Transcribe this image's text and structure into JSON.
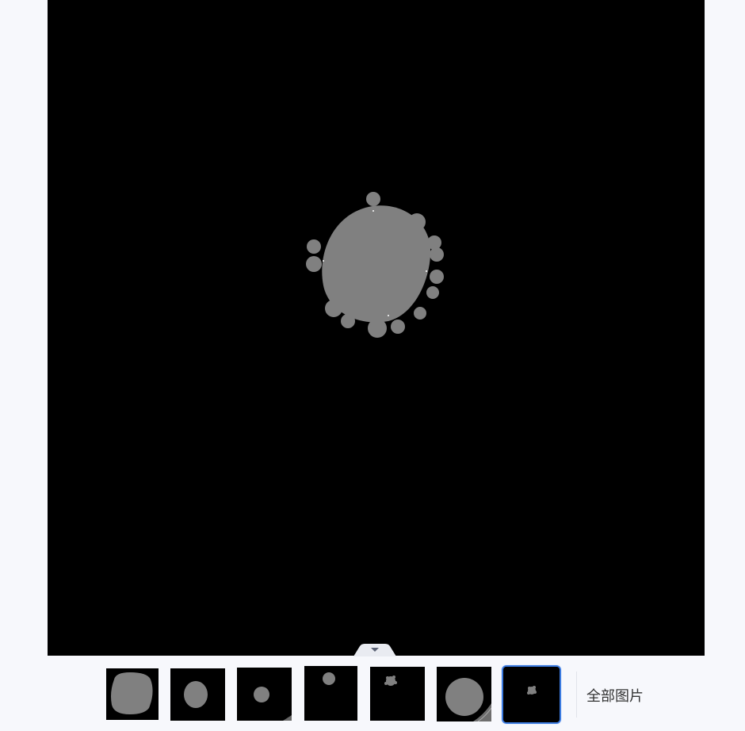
{
  "viewer": {
    "image_name": "segmentation-mask-image",
    "background_color": "#000000",
    "mask_color": "#808080"
  },
  "collapse_toggle": {
    "icon": "triangle-down-icon"
  },
  "thumbnails": [
    {
      "name": "thumbnail-1",
      "selected": false
    },
    {
      "name": "thumbnail-2",
      "selected": false
    },
    {
      "name": "thumbnail-3",
      "selected": false
    },
    {
      "name": "thumbnail-4",
      "selected": false
    },
    {
      "name": "thumbnail-5",
      "selected": false
    },
    {
      "name": "thumbnail-6",
      "selected": false
    },
    {
      "name": "thumbnail-7",
      "selected": true
    }
  ],
  "all_images_label": "全部图片",
  "colors": {
    "selection_border": "#3c7be0",
    "page_background": "#f7f8fc"
  }
}
